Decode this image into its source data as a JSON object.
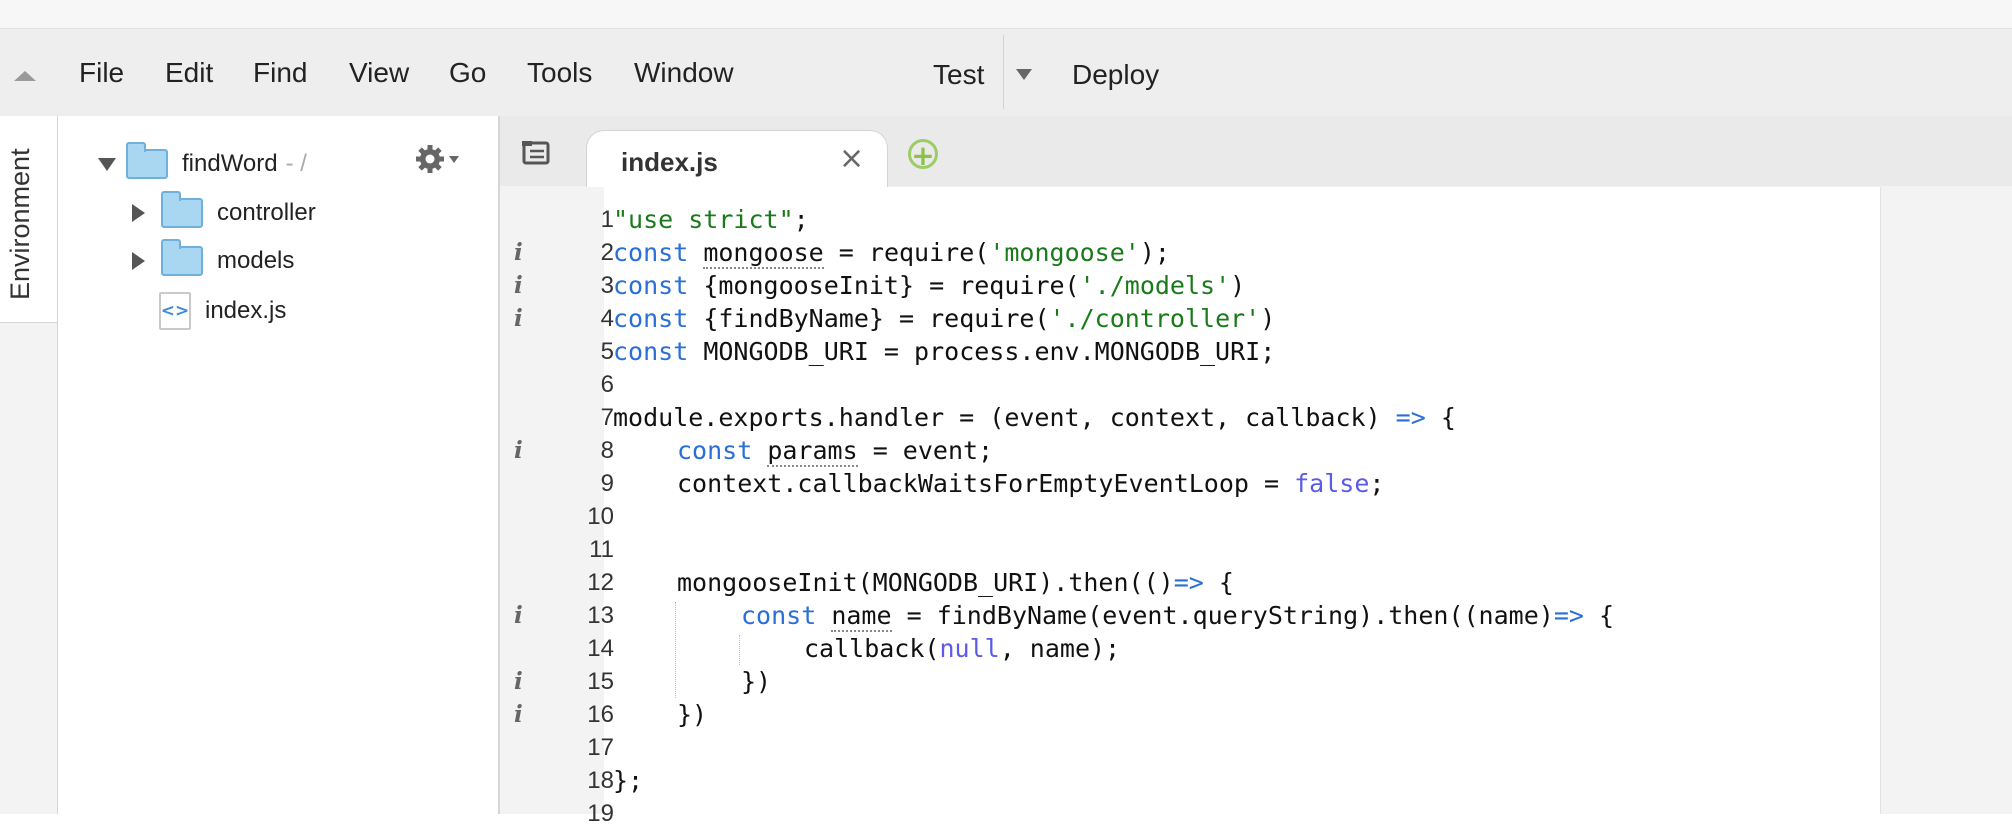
{
  "menubar": {
    "items": [
      {
        "label": "File"
      },
      {
        "label": "Edit"
      },
      {
        "label": "Find"
      },
      {
        "label": "View"
      },
      {
        "label": "Go"
      },
      {
        "label": "Tools"
      },
      {
        "label": "Window"
      }
    ],
    "test_label": "Test",
    "deploy_label": "Deploy"
  },
  "side_tab": {
    "label": "Environment"
  },
  "file_tree": {
    "root": {
      "name": "findWord",
      "suffix": "- /"
    },
    "children": [
      {
        "name": "controller",
        "type": "folder"
      },
      {
        "name": "models",
        "type": "folder"
      },
      {
        "name": "index.js",
        "type": "file",
        "icon": "js-file-icon"
      }
    ]
  },
  "editor": {
    "active_tab": "index.js",
    "close_glyph": "×",
    "add_glyph": "+",
    "lines": [
      {
        "n": "1",
        "info": false
      },
      {
        "n": "2",
        "info": true
      },
      {
        "n": "3",
        "info": true
      },
      {
        "n": "4",
        "info": true
      },
      {
        "n": "5",
        "info": false
      },
      {
        "n": "6",
        "info": false
      },
      {
        "n": "7",
        "info": false
      },
      {
        "n": "8",
        "info": true
      },
      {
        "n": "9",
        "info": false
      },
      {
        "n": "10",
        "info": false
      },
      {
        "n": "11",
        "info": false
      },
      {
        "n": "12",
        "info": false
      },
      {
        "n": "13",
        "info": true
      },
      {
        "n": "14",
        "info": false
      },
      {
        "n": "15",
        "info": true
      },
      {
        "n": "16",
        "info": true
      },
      {
        "n": "17",
        "info": false
      },
      {
        "n": "18",
        "info": false
      },
      {
        "n": "19",
        "info": false
      }
    ],
    "code": {
      "l1_str": "\"use strict\"",
      "l1_end": ";",
      "kw_const": "const",
      "l2_var": "mongoose",
      "l2_mid": " = require(",
      "l2_str": "'mongoose'",
      "l2_end": ");",
      "l3_mid": " {mongooseInit} = require(",
      "l3_str": "'./models'",
      "l3_end": ")",
      "l4_mid": " {findByName} = require(",
      "l4_str": "'./controller'",
      "l4_end": ")",
      "l5_mid": " MONGODB_URI = process.env.MONGODB_URI;",
      "l7_a": "module.exports.handler = (event, context, callback) ",
      "arrow": "=>",
      "l7_b": " {",
      "l8_var": "params",
      "l8_end": " = event;",
      "l9_a": "context.callbackWaitsForEmptyEventLoop = ",
      "l9_false": "false",
      "l9_end": ";",
      "l12_a": "mongooseInit(MONGODB_URI).then(()",
      "l12_b": " {",
      "l13_var": "name",
      "l13_mid": " = findByName(event.queryString).then((name)",
      "l13_end": " {",
      "l14_a": "callback(",
      "l14_null": "null",
      "l14_end": ", name);",
      "l15": "})",
      "l16": "})",
      "l18": "};"
    }
  }
}
